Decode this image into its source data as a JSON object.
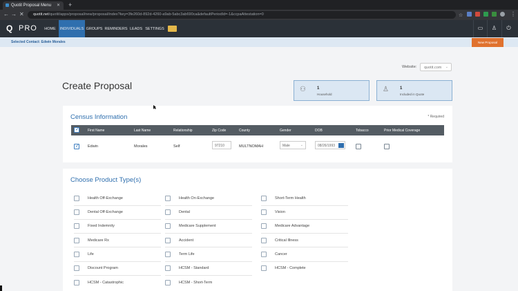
{
  "browser": {
    "tab_title": "Quotit Proposal Menu",
    "new_tab": "+",
    "url_host": "quotit.net",
    "url_path": "/quotit/apps/proposal/new/proposal/index?key=3fe260d-892d-4260-a9ab-5abc3ab690ca&defaultPeriodId=-1&ccpaAttestation=0"
  },
  "app": {
    "logo_letter": "Q",
    "logo_text": "PRO",
    "nav": [
      "HOME",
      "INDIVIDUALS",
      "GROUPS",
      "REMINDERS",
      "LEADS",
      "SETTINGS"
    ],
    "selected_contact": "Selected Contact: Edwin Morales",
    "new_proposal": "New Proposal",
    "colors": {
      "nav_bg": "#2b3138",
      "active": "#2f6fae",
      "accent": "#e0722f",
      "panel_title": "#2f6fae"
    }
  },
  "website": {
    "label": "Website:",
    "value": "quotit.com"
  },
  "page": {
    "title": "Create Proposal"
  },
  "stats": [
    {
      "value": "1",
      "label": "Household",
      "icon": "household-icon"
    },
    {
      "value": "1",
      "label": "Included in Quote",
      "icon": "person-icon"
    }
  ],
  "census": {
    "title": "Census Information",
    "required": "* Required",
    "headers": [
      "First Name",
      "Last Name",
      "Relationship",
      "Zip Code",
      "County",
      "Gender",
      "DOB",
      "Tobacco",
      "Prior Medical Coverage"
    ],
    "row": {
      "first": "Edwin",
      "last": "Morales",
      "relationship": "Self",
      "zip": "97210",
      "county": "MULTNOMAH",
      "gender": "Male",
      "dob": "08/26/1993"
    }
  },
  "products": {
    "title": "Choose Product Type(s)",
    "columns": [
      [
        "Health Off-Exchange",
        "Dental Off-Exchange",
        "Fixed Indemnity",
        "Medicare Rx",
        "Life",
        "Discount Program",
        "HCSM - Catastrophic"
      ],
      [
        "Health On-Exchange",
        "Dental",
        "Medicare Supplement",
        "Accident",
        "Term Life",
        "HCSM - Standard",
        "HCSM - Short-Term"
      ],
      [
        "Short-Term Health",
        "Vision",
        "Medicare Advantage",
        "Critical Illness",
        "Cancer",
        "HCSM - Complete"
      ]
    ]
  }
}
